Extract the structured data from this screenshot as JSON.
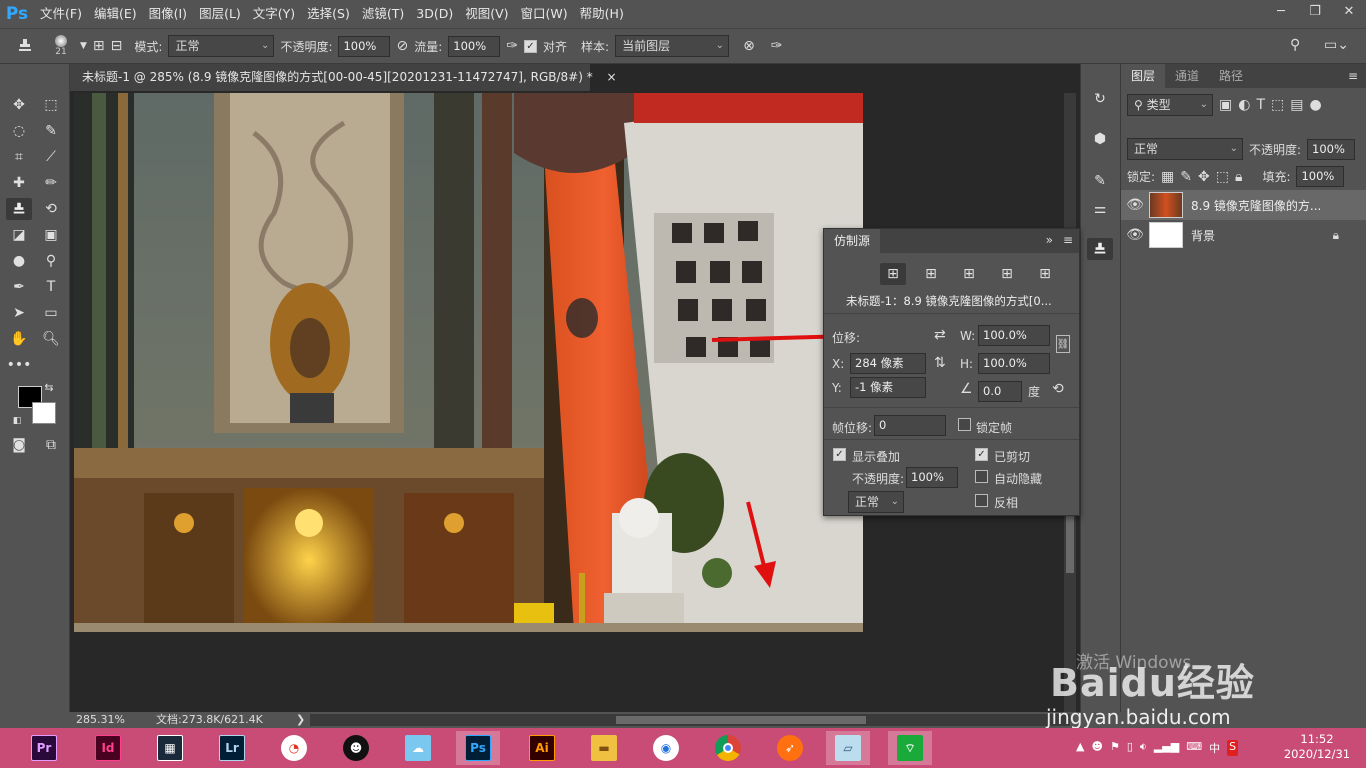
{
  "menubar": {
    "logo": "Ps",
    "items": [
      "文件(F)",
      "编辑(E)",
      "图像(I)",
      "图层(L)",
      "文字(Y)",
      "选择(S)",
      "滤镜(T)",
      "3D(D)",
      "视图(V)",
      "窗口(W)",
      "帮助(H)"
    ]
  },
  "options": {
    "brush_size": "21",
    "mode_label": "模式:",
    "mode_value": "正常",
    "opacity_label": "不透明度:",
    "opacity_value": "100%",
    "flow_label": "流量:",
    "flow_value": "100%",
    "align_label": "对齐",
    "sample_label": "样本:",
    "sample_value": "当前图层"
  },
  "document": {
    "tab_title": "未标题-1 @ 285% (8.9 镜像克隆图像的方式[00-00-45][20201231-11472747], RGB/8#) *",
    "close": "×"
  },
  "status": {
    "zoom": "285.31%",
    "doc_size": "文档:273.8K/621.4K",
    "arrow": "❯"
  },
  "clone_source": {
    "title": "仿制源",
    "source_name": "未标题-1：8.9 镜像克隆图像的方式[0...",
    "offset_label": "位移:",
    "w_label": "W:",
    "w_value": "100.0%",
    "h_label": "H:",
    "h_value": "100.0%",
    "x_label": "X:",
    "x_value": "284 像素",
    "y_label": "Y:",
    "y_value": "-1 像素",
    "angle_value": "0.0",
    "angle_unit": "度",
    "frame_offset_label": "帧位移:",
    "frame_offset_value": "0",
    "lock_frame_label": "锁定帧",
    "show_overlay_label": "显示叠加",
    "clipped_label": "已剪切",
    "overlay_opacity_label": "不透明度:",
    "overlay_opacity_value": "100%",
    "auto_hide_label": "自动隐藏",
    "blend_value": "正常",
    "invert_label": "反相"
  },
  "layers": {
    "tabs": [
      "图层",
      "通道",
      "路径"
    ],
    "filter_kind": "类型",
    "blend_mode": "正常",
    "opacity_label": "不透明度:",
    "opacity_value": "100%",
    "lock_label": "锁定:",
    "fill_label": "填充:",
    "fill_value": "100%",
    "items": [
      {
        "name": "8.9 镜像克隆图像的方..."
      },
      {
        "name": "背景"
      }
    ]
  },
  "watermark": {
    "activate": "激活 Windows",
    "baidu": "Baidu经验",
    "url": "jingyan.baidu.com"
  },
  "taskbar": {
    "apps": [
      "Pr",
      "Id",
      "",
      "Lr",
      "",
      "",
      "",
      "Ps",
      "Ai",
      "",
      "",
      "",
      "",
      "",
      ""
    ],
    "time": "11:52",
    "date": "2020/12/31",
    "ime": "中"
  }
}
